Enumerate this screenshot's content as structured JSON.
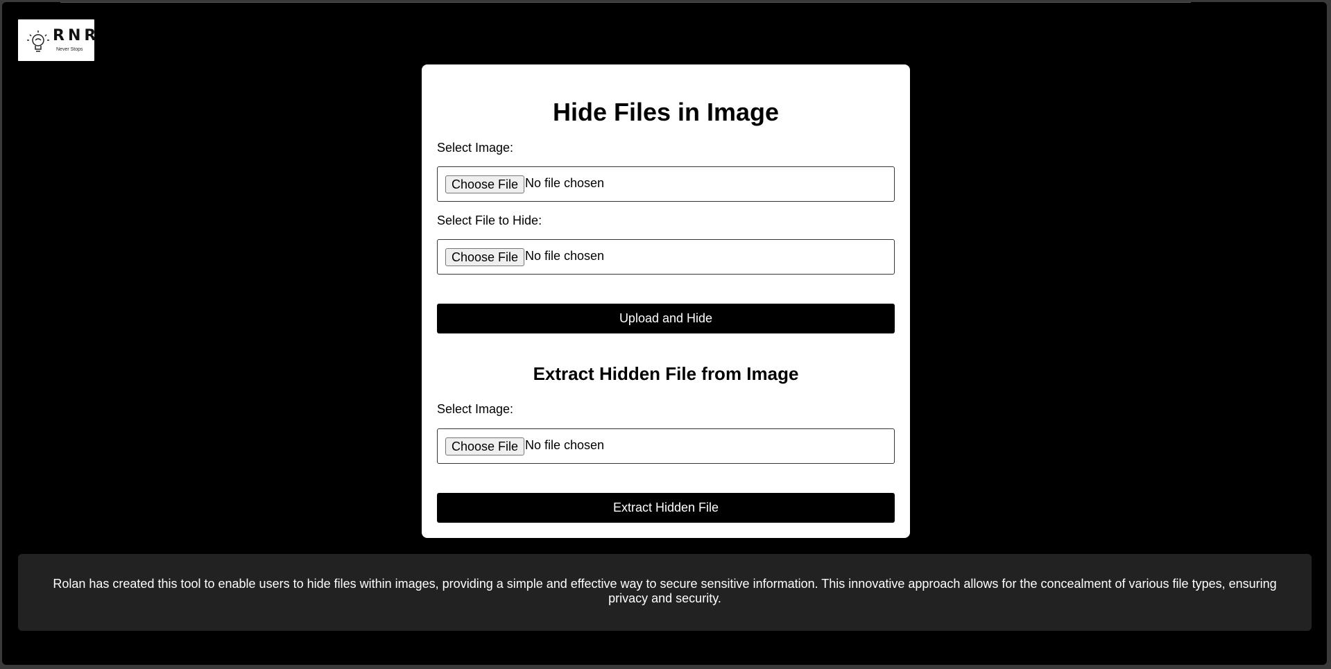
{
  "logo": {
    "name": "RNR",
    "tagline": "Never Stops"
  },
  "hide_section": {
    "title": "Hide Files in Image",
    "image_label": "Select Image:",
    "file_label": "Select File to Hide:",
    "choose_button": "Choose File",
    "no_file_text": "No file chosen",
    "submit_label": "Upload and Hide"
  },
  "extract_section": {
    "title": "Extract Hidden File from Image",
    "image_label": "Select Image:",
    "choose_button": "Choose File",
    "no_file_text": "No file chosen",
    "submit_label": "Extract Hidden File"
  },
  "footer": {
    "text": "Rolan has created this tool to enable users to hide files within images, providing a simple and effective way to secure sensitive information. This innovative approach allows for the concealment of various file types, ensuring privacy and security."
  },
  "colors": {
    "background": "#000000",
    "card": "#ffffff",
    "button": "#000000",
    "footer": "#222222"
  }
}
